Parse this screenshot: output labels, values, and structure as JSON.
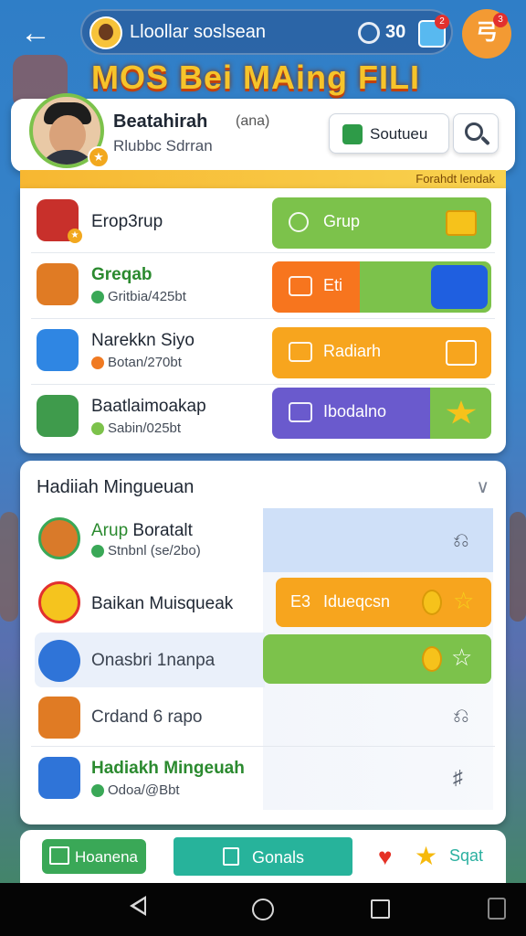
{
  "topbar": {
    "username": "Lloollar soslsean",
    "coins": "30",
    "gift_badge": "2",
    "right_button_label": "弓",
    "right_button_badge": "3"
  },
  "banner": {
    "title": "MOS Bei MAing FILI"
  },
  "profile": {
    "name": "Beatahirah",
    "tag": "(ana)",
    "subtitle": "Rlubbc Sdrran",
    "solution_label": "Soutueu"
  },
  "strip": {
    "left_text": "",
    "right_text": "Forahdt lendak"
  },
  "list1": [
    {
      "title": "Erop3rup",
      "subtitle": "",
      "action_label": "Grup",
      "action_color": "#7cc24b"
    },
    {
      "title": "Greqab",
      "subtitle": "Gritbia/425bt",
      "action_label": "Eti",
      "action_color": "#f7751e"
    },
    {
      "title": "Narekkn Siyo",
      "subtitle": "Botan/270bt",
      "action_label": "Radiarh",
      "action_color": "#f7a51e"
    },
    {
      "title": "Baatlaimoakap",
      "subtitle": "Sabin/025bt",
      "action_label": "Ibodalno",
      "action_color": "#6a5acd"
    }
  ],
  "panel2": {
    "title": "Hadiiah Mingueuan",
    "items": [
      {
        "title": "Arup Boratalt",
        "title_accent": "Arup",
        "subtitle": "Stnbnl (se/2bo)"
      },
      {
        "title": "Baikan Muisqueak",
        "subtitle": "",
        "action_label": "Idueqcsn",
        "action_prefix": "E3"
      },
      {
        "title": "Onasbri 1nanpa",
        "subtitle": ""
      },
      {
        "title": "Crdand 6 rapo",
        "subtitle": ""
      },
      {
        "title": "Hadiakh Mingeuah",
        "subtitle": "Odoa/@Bbt"
      }
    ]
  },
  "bottom_bar": {
    "home_label": "Hoanena",
    "goals_label": "Gonals",
    "start_label": "Sqat"
  },
  "colors": {
    "accent_green": "#3aa857",
    "accent_teal": "#27b39b",
    "accent_orange": "#f7751e",
    "accent_yellow": "#f7a51e",
    "accent_purple": "#6a5acd"
  }
}
